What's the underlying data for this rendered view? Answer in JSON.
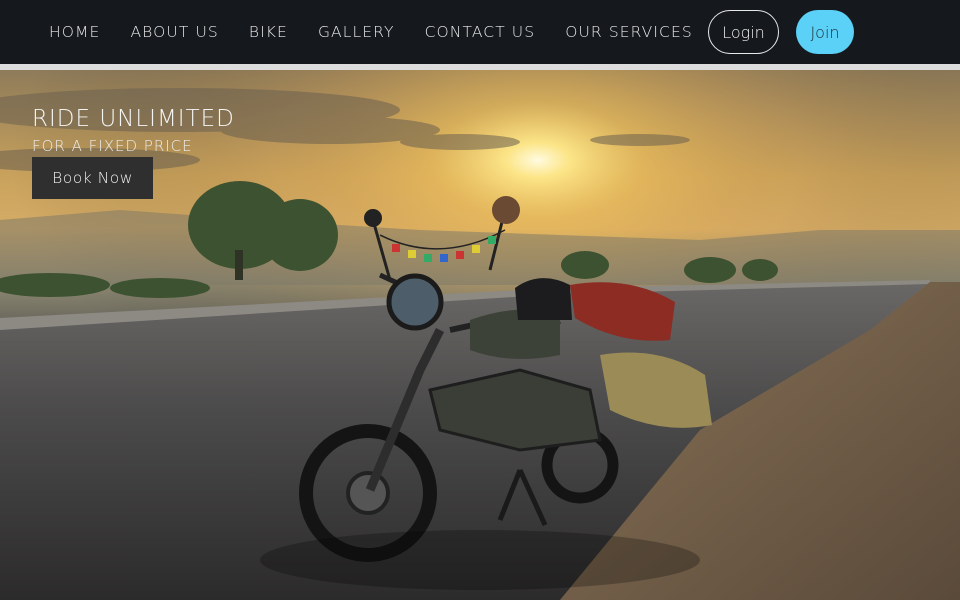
{
  "nav": {
    "links": [
      "HOME",
      "ABOUT US",
      "BIKE",
      "GALLERY",
      "CONTACT US",
      "OUR SERVICES"
    ],
    "login_label": "Login",
    "join_label": "Join"
  },
  "hero": {
    "title": "RIDE UNLIMITED",
    "subtitle": "FOR A FIXED PRICE",
    "cta_label": "Book Now",
    "image_alt": "Motorcycle parked on a road at sunrise"
  },
  "colors": {
    "navbar_bg": "#15181c",
    "join_button": "#5bd1f7",
    "book_button": "#2f2f2f"
  }
}
